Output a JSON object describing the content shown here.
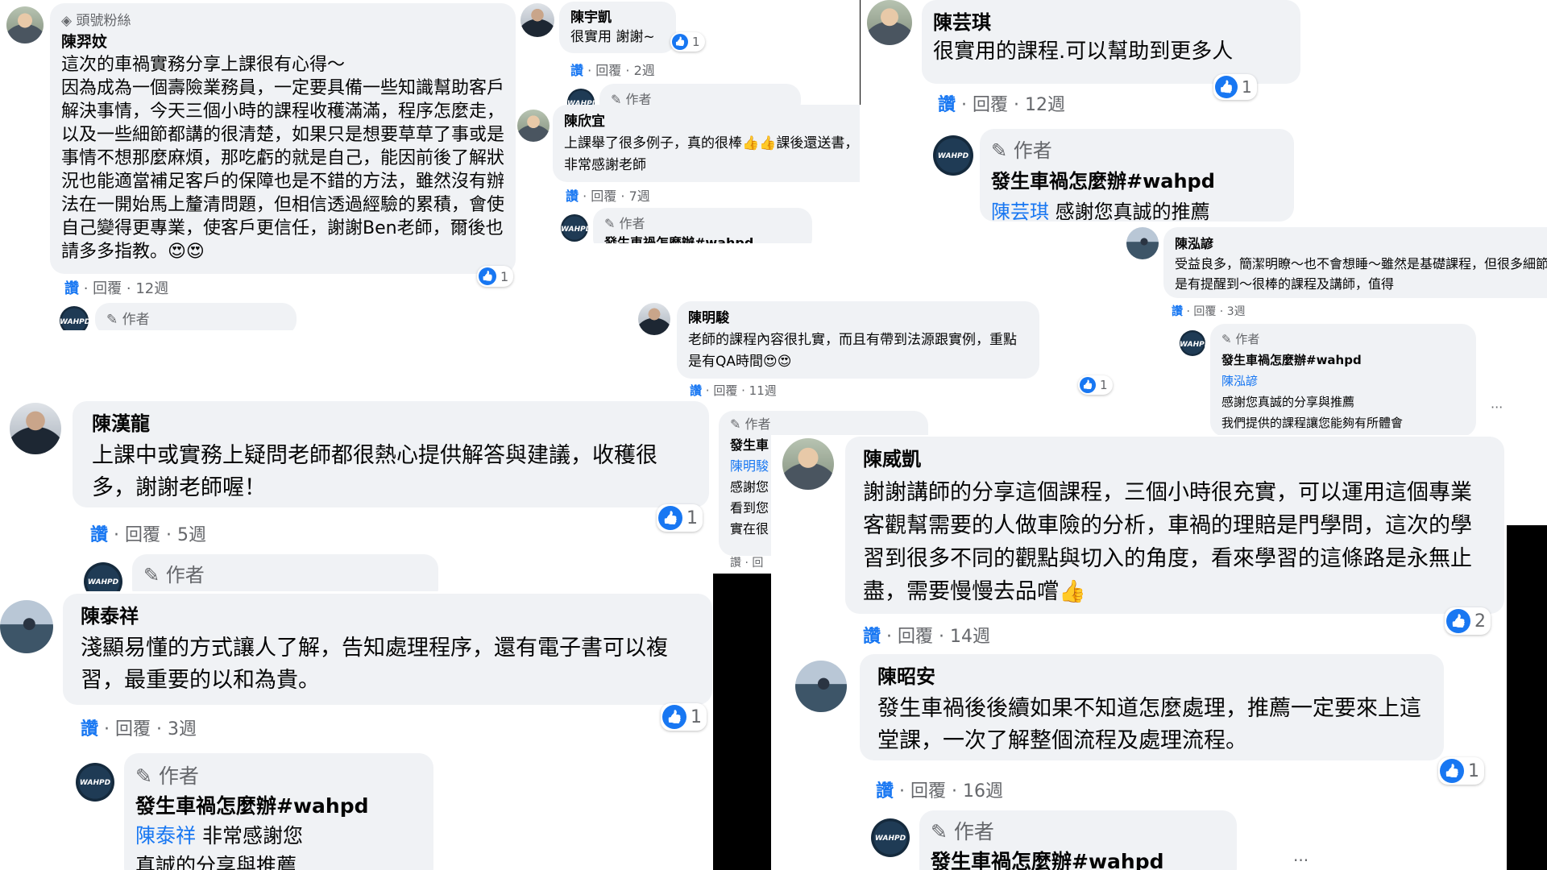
{
  "c1": {
    "badge": "頭號粉絲",
    "name": "陳羿妏",
    "text": "這次的車禍實務分享上課很有心得～\n因為成為一個壽險業務員，一定要具備一些知識幫助客戶解決事情，今天三個小時的課程收穫滿滿，程序怎麼走，以及一些細節都講的很清楚，如果只是想要草草了事或是事情不想那麼麻煩，那吃虧的就是自己，能因前後了解狀況也能適當補足客戶的保障也是不錯的方法，雖然沒有辦法在一開始馬上釐清問題，但相信透過經驗的累積，會使自己變得更專業，使客戶更信任，謝謝Ben老師，爾後也請多多指教。😍😍",
    "like": "讚",
    "reply": "回覆",
    "time": "12週",
    "count": "1",
    "author": "作者"
  },
  "c2": {
    "name": "陳宇凱",
    "text": "很實用 謝謝~",
    "like": "讚",
    "reply": "回覆",
    "time": "2週",
    "count": "1",
    "author": "作者"
  },
  "c3": {
    "name": "陳欣宜",
    "text": "上課舉了很多例子，真的很棒👍👍課後還送書，非常感謝老師",
    "like": "讚",
    "reply": "回覆",
    "time": "7週",
    "author": "作者",
    "page": "發生車禍怎麼辦#wahpd"
  },
  "c4": {
    "name": "陳芸琪",
    "text": "很實用的課程.可以幫助到更多人",
    "like": "讚",
    "reply": "回覆",
    "time": "12週",
    "count": "1",
    "author": "作者",
    "page": "發生車禍怎麼辦#wahpd",
    "tag": "陳芸琪",
    "reply_text": "感謝您真誠的推薦"
  },
  "c5": {
    "name": "陳泓諺",
    "text": "受益良多，簡潔明瞭～也不會想睡～雖然是基礎課程，但很多細節都還是有提醒到～很棒的課程及講師，值得",
    "like": "讚",
    "reply": "回覆",
    "time": "3週",
    "author": "作者",
    "page": "發生車禍怎麼辦#wahpd",
    "tag": "陳泓諺",
    "reply_text": "感謝您真誠的分享與推薦",
    "reply_text2": "我們提供的課程讓您能夠有所體會",
    "more": "···"
  },
  "c6": {
    "name": "陳明駿",
    "text": "老師的課程內容很扎實，而且有帶到法源跟實例，重點是有QA時間😍😍",
    "like": "讚",
    "reply": "回覆",
    "time": "11週",
    "count": "1",
    "author": "作者",
    "page": "發生車",
    "tag": "陳明駿",
    "lines": [
      "感謝您",
      "看到您",
      "實在很"
    ],
    "meta2": "讚 · 回"
  },
  "c7": {
    "name": "陳漢龍",
    "text": "上課中或實務上疑問老師都很熱心提供解答與建議，收穫很多，謝謝老師喔！",
    "like": "讚",
    "reply": "回覆",
    "time": "5週",
    "count": "1",
    "author": "作者"
  },
  "c8": {
    "name": "陳威凱",
    "text": "謝謝講師的分享這個課程，三個小時很充實，可以運用這個專業客觀幫需要的人做車險的分析，車禍的理賠是門學問，這次的學習到很多不同的觀點與切入的角度，看來學習的這條路是永無止盡，需要慢慢去品嚐👍",
    "like": "讚",
    "reply": "回覆",
    "time": "14週",
    "count": "2"
  },
  "c9": {
    "name": "陳泰祥",
    "text": "淺顯易懂的方式讓人了解，告知處理程序，還有電子書可以複習，最重要的以和為貴。",
    "like": "讚",
    "reply": "回覆",
    "time": "3週",
    "count": "1",
    "author": "作者",
    "page": "發生車禍怎麼辦#wahpd",
    "tag": "陳泰祥",
    "reply_text": "非常感謝您",
    "reply_text2": "真誠的分享與推薦"
  },
  "c10": {
    "name": "陳昭安",
    "text": "發生車禍後後續如果不知道怎麼處理，推薦一定要來上這堂課，一次了解整個流程及處理流程。",
    "like": "讚",
    "reply": "回覆",
    "time": "16週",
    "count": "1",
    "author": "作者",
    "page": "發生車禍怎麼辦#wahpd",
    "more": "···"
  },
  "logo_text": "WAHPD",
  "colors": {
    "bubble": "#f0f2f5",
    "like_blue": "#1877f2",
    "meta_gray": "#65676b"
  }
}
